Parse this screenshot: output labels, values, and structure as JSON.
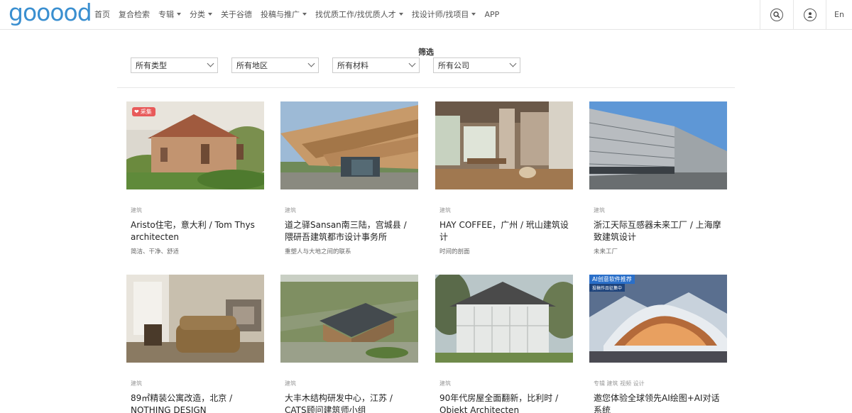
{
  "brand": {
    "logo": "gooood"
  },
  "nav": {
    "items": [
      {
        "label": "首页",
        "dropdown": false
      },
      {
        "label": "复合检索",
        "dropdown": false
      },
      {
        "label": "专辑",
        "dropdown": true
      },
      {
        "label": "分类",
        "dropdown": true
      },
      {
        "label": "关于谷德",
        "dropdown": false
      },
      {
        "label": "投稿与推广",
        "dropdown": true
      },
      {
        "label": "找优质工作/找优质人才",
        "dropdown": true
      },
      {
        "label": "找设计师/找项目",
        "dropdown": true
      },
      {
        "label": "APP",
        "dropdown": false
      }
    ],
    "lang": "En",
    "icons": [
      "search-icon",
      "user-icon"
    ]
  },
  "filters": {
    "title": "筛选",
    "selects": [
      "所有类型",
      "所有地区",
      "所有材料",
      "所有公司"
    ]
  },
  "cards": [
    {
      "category": "建筑",
      "title": "Aristo住宅，意大利 / Tom Thys architecten",
      "subtitle": "简洁、干净、舒适",
      "badge": "采集"
    },
    {
      "category": "建筑",
      "title": "道之驿Sansan南三陆，宫城县 / 隈研吾建筑都市设计事务所",
      "subtitle": "重塑人与大地之间的联系"
    },
    {
      "category": "建筑",
      "title": "HAY COFFEE，广州 / 玳山建筑设计",
      "subtitle": "时间的剖面"
    },
    {
      "category": "建筑",
      "title": "浙江天际互感器未来工厂 / 上海摩致建筑设计",
      "subtitle": "未来工厂"
    },
    {
      "category": "建筑",
      "title": "89㎡精装公寓改造，北京 / NOTHING DESIGN",
      "subtitle": ""
    },
    {
      "category": "建筑",
      "title": "大丰木结构研发中心，江苏 / CATS顾问建筑师小组",
      "subtitle": ""
    },
    {
      "category": "建筑",
      "title": "90年代房屋全面翻新，比利时 / Objekt Architecten",
      "subtitle": ""
    },
    {
      "category": "专辑   建筑   视频   设计",
      "title": "邀您体验全球领先AI绘图+AI对话系统",
      "subtitle": "",
      "ai_badge": "AI创意软件推荐",
      "ai_sub": "投稿作品征集中"
    }
  ],
  "colors": {
    "brand": "#3a8fd0",
    "badge": "#e85a5a"
  }
}
